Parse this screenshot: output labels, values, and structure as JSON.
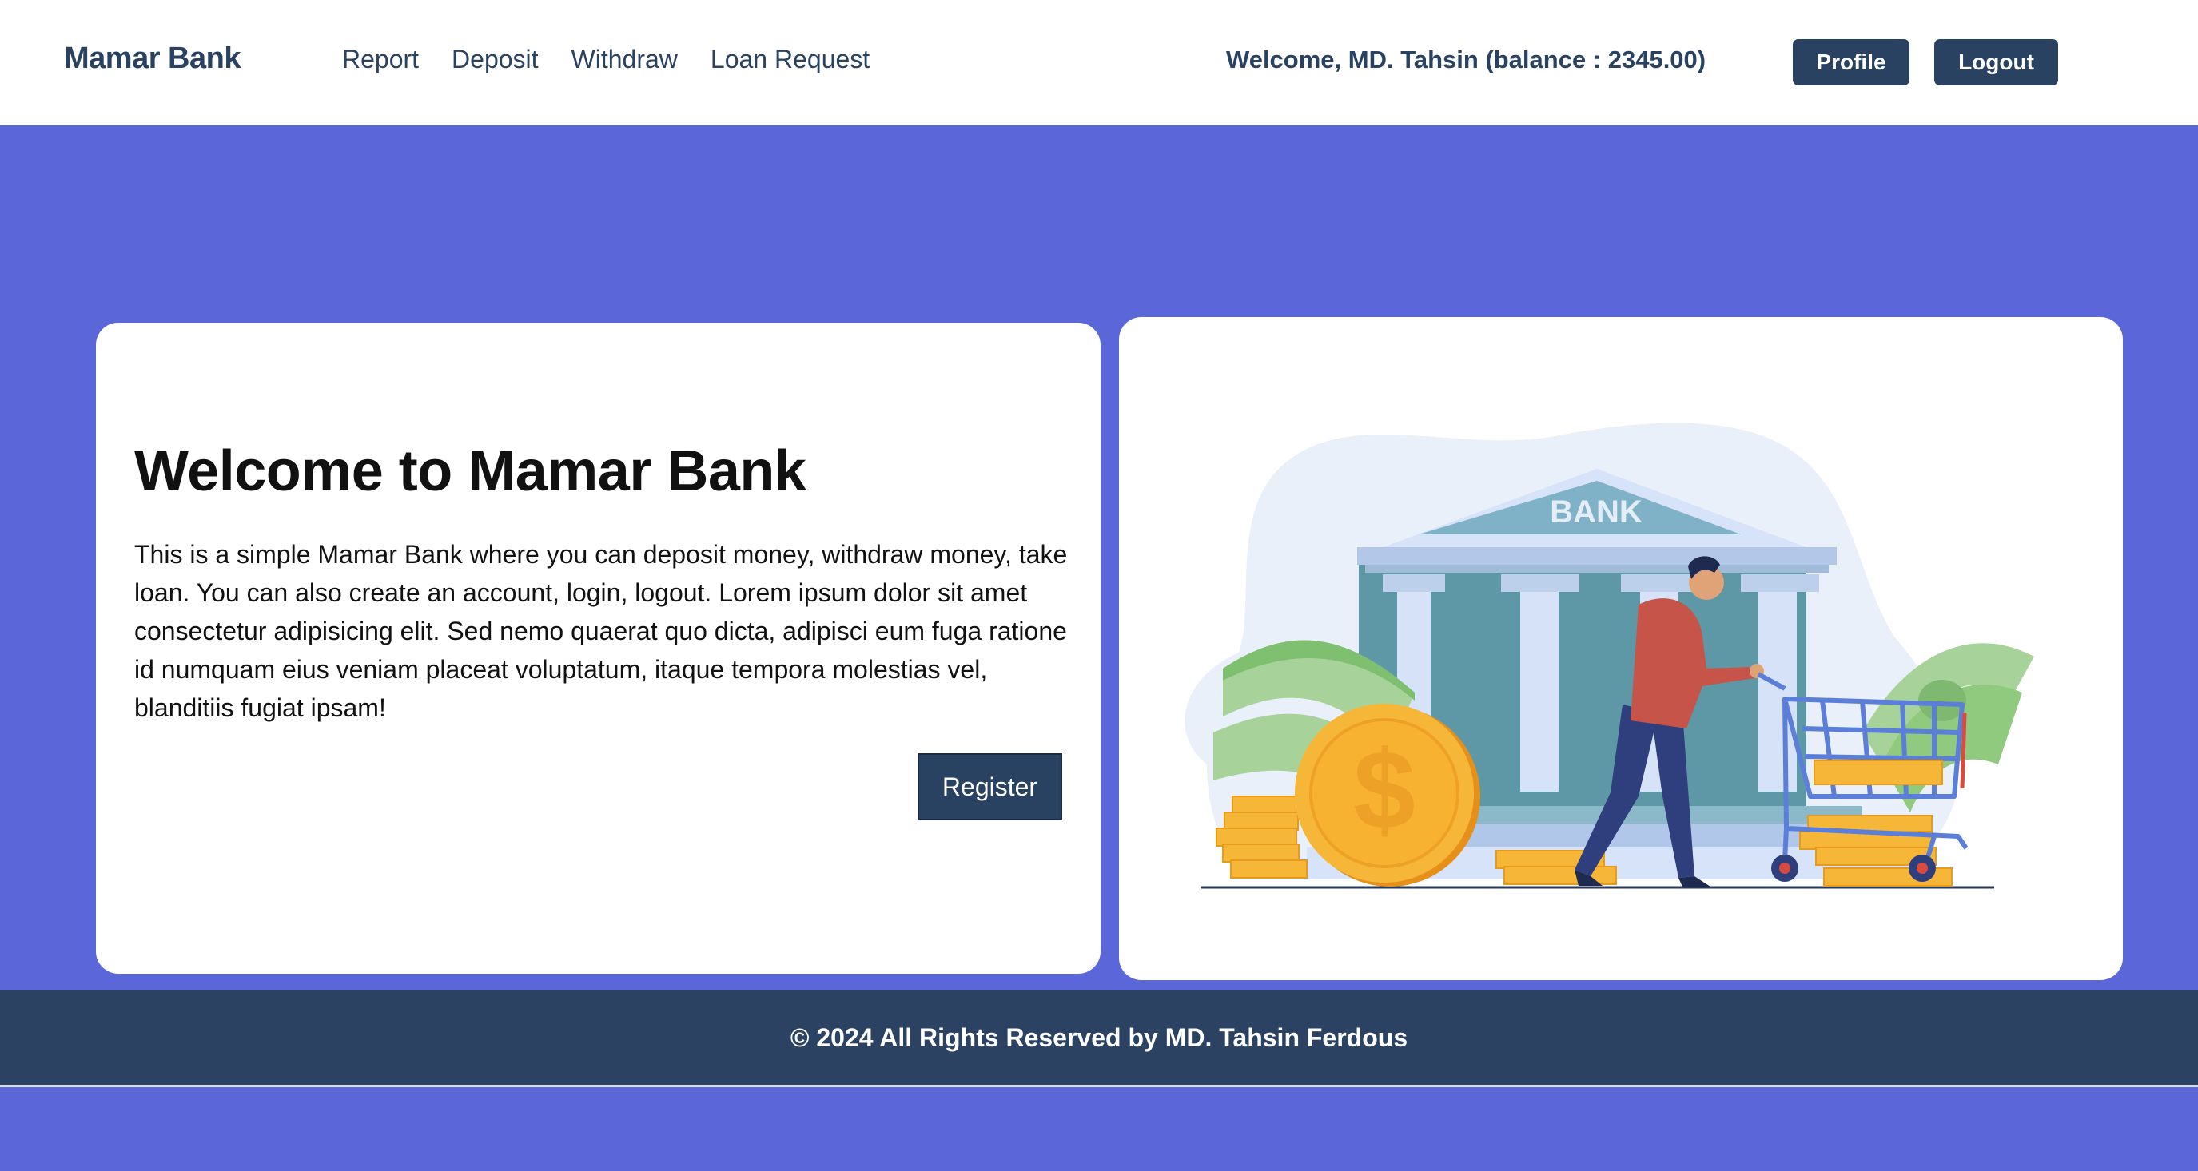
{
  "navbar": {
    "brand": "Mamar Bank",
    "links": [
      "Report",
      "Deposit",
      "Withdraw",
      "Loan Request"
    ],
    "welcome": "Welcome, MD. Tahsin (balance : 2345.00)",
    "profile_label": "Profile",
    "logout_label": "Logout"
  },
  "hero": {
    "title": "Welcome to Mamar Bank",
    "text": "This is a simple Mamar Bank where you can deposit money, withdraw money, take loan. You can also create an account, login, logout. Lorem ipsum dolor sit amet consectetur adipisicing elit. Sed nemo quaerat quo dicta, adipisci eum fuga ratione id numquam eius veniam placeat voluptatum, itaque tempora molestias vel, blanditiis fugiat ipsam!",
    "register_label": "Register"
  },
  "illustration": {
    "bank_sign": "BANK",
    "coin_symbol": "$"
  },
  "footer": {
    "text": "© 2024 All Rights Reserved by MD. Tahsin Ferdous"
  },
  "colors": {
    "page_bg": "#5b67d8",
    "primary": "#2a4262",
    "card_bg": "#ffffff"
  }
}
